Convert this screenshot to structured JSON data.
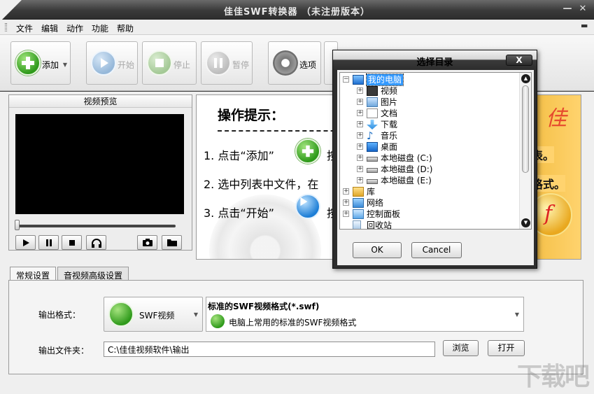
{
  "window": {
    "title": "佳佳SWF转换器  （未注册版本）"
  },
  "menu": {
    "items": [
      "文件",
      "编辑",
      "动作",
      "功能",
      "帮助"
    ]
  },
  "toolbar": {
    "add": "添加",
    "start": "开始",
    "stop": "停止",
    "pause": "暂停",
    "options": "选项"
  },
  "preview": {
    "title": "视频预览",
    "progress": 0
  },
  "hints": {
    "title": "操作提示：",
    "line1_a": "1. 点击“添加”",
    "line1_b": "按",
    "line2": "2. 选中列表中文件，在",
    "line3_a": "3. 点击“开始”",
    "line3_b": "按",
    "side_char": "佳",
    "side_text1": "表。",
    "side_text2": "格式。"
  },
  "tabs": [
    "常规设置",
    "音视频高级设置"
  ],
  "settings": {
    "format_label": "输出格式：",
    "format_value": "SWF视频",
    "format_desc_title": "标准的SWF视频格式(*.swf)",
    "format_desc_sub": "电脑上常用的标准的SWF视频格式",
    "folder_label": "输出文件夹：",
    "folder_value": "C:\\佳佳视频软件\\输出",
    "browse": "浏览",
    "open": "打开"
  },
  "dialog": {
    "title": "选择目录",
    "close": "X",
    "tree": [
      {
        "label": "我的电脑",
        "level": 0,
        "expander": "−",
        "icon": "computer-icon",
        "selected": true
      },
      {
        "label": "视频",
        "level": 1,
        "expander": "+",
        "icon": "video-folder-icon"
      },
      {
        "label": "图片",
        "level": 1,
        "expander": "+",
        "icon": "pictures-folder-icon"
      },
      {
        "label": "文档",
        "level": 1,
        "expander": "+",
        "icon": "documents-folder-icon"
      },
      {
        "label": "下载",
        "level": 1,
        "expander": "+",
        "icon": "downloads-icon"
      },
      {
        "label": "音乐",
        "level": 1,
        "expander": "+",
        "icon": "music-icon"
      },
      {
        "label": "桌面",
        "level": 1,
        "expander": "+",
        "icon": "desktop-icon"
      },
      {
        "label": "本地磁盘 (C:)",
        "level": 1,
        "expander": "+",
        "icon": "drive-c-icon"
      },
      {
        "label": "本地磁盘 (D:)",
        "level": 1,
        "expander": "+",
        "icon": "drive-icon"
      },
      {
        "label": "本地磁盘 (E:)",
        "level": 1,
        "expander": "+",
        "icon": "drive-icon"
      },
      {
        "label": "库",
        "level": 0,
        "expander": "+",
        "icon": "library-icon"
      },
      {
        "label": "网络",
        "level": 0,
        "expander": "+",
        "icon": "network-icon"
      },
      {
        "label": "控制面板",
        "level": 0,
        "expander": "+",
        "icon": "control-panel-icon"
      },
      {
        "label": "回收站",
        "level": 0,
        "expander": "",
        "icon": "recycle-bin-icon"
      }
    ],
    "ok": "OK",
    "cancel": "Cancel"
  },
  "watermark": "下载吧"
}
